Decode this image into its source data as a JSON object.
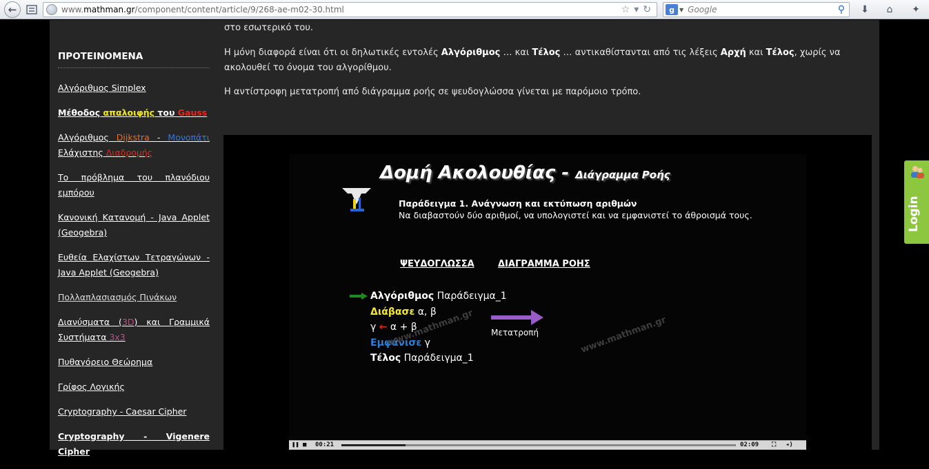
{
  "browser": {
    "url_prefix": "www.",
    "url_host": "mathman.gr",
    "url_path": "/component/content/article/9/268-ae-m02-30.html",
    "search_placeholder": "Google",
    "search_engine_letter": "g"
  },
  "sidebar": {
    "title": "ΠΡΟΤΕΙΝΟΜΕΝΑ",
    "items": {
      "simplex": "Αλγόριθμος Simplex",
      "gauss_1": "Μέθοδος ",
      "gauss_2": "απαλοιφής",
      "gauss_3": " του ",
      "gauss_4": "Gauss",
      "dijkstra_1": "Αλγόριθμος ",
      "dijkstra_2": "Dijkstra",
      "dijkstra_3": " - ",
      "dijkstra_4": "Μονοπάτι",
      "dijkstra_5": " Ελάχιστης ",
      "dijkstra_6": "Διαδρομής",
      "tsp": "Το πρόβλημα του πλανόδιου εμπόρου",
      "normal": "Κανονική Κατανομή - Java Applet (Geogebra)",
      "least_squares": "Ευθεία Ελαχίστων Τετραγώνων - Java Applet (Geogebra)",
      "matrix": "Πολλαπλασιασμός Πινάκων",
      "vectors_1": "Διανύσματα (",
      "vectors_2": "3D",
      "vectors_3": ") και Γραμμικά Συστήματα ",
      "vectors_4": "3x3",
      "pythagoras": "Πυθαγόρειο Θεώρημα",
      "logic": "Γρίφος Λογικής",
      "caesar": "Cryptography - Caesar Cipher",
      "vigenere": "Cryptography - Vigenere Cipher"
    }
  },
  "content": {
    "p0": "στο εσωτερικό του.",
    "p1_a": "Η μόνη διαφορά είναι ότι οι δηλωτικές εντολές ",
    "p1_b": "Αλγόριθμος",
    "p1_c": " … και ",
    "p1_d": "Τέλος",
    "p1_e": " … αντικαθίστανται από τις λέξεις ",
    "p1_f": "Αρχή",
    "p1_g": " και ",
    "p1_h": "Τέλος",
    "p1_i": ", χωρίς να ακολουθεί το όνομα του αλγορίθμου.",
    "p2": "Η αντίστροφη μετατροπή από διάγραμμα ροής σε ψευδογλώσσα γίνεται με παρόμοιο τρόπο."
  },
  "video": {
    "title_main": "Δομή Ακολουθίας - ",
    "title_sub": "Διάγραμμα Ροής",
    "example_title": "Παράδειγμα 1. Ανάγνωση και εκτύπωση αριθμών",
    "example_desc": "Να διαβαστούν δύο αριθμοί, να υπολογιστεί και να εμφανιστεί το άθροισμά τους.",
    "col_pseudo": "ΨΕΥΔΟΓΛΩΣΣΑ",
    "col_flow": "ΔΙΑΓΡΑΜΜΑ ΡΟΗΣ",
    "code": {
      "l1_kw": "Αλγόριθμος",
      "l1_rest": " Παράδειγμα_1",
      "l2_kw": "Διάβασε",
      "l2_rest": "  α, β",
      "l3_a": "γ ",
      "l3_arrow": "←",
      "l3_b": " α + β",
      "l4_kw": "Εμφάνισε",
      "l4_rest": "  γ",
      "l5_kw": "Τέλος",
      "l5_rest": "  Παράδειγμα_1"
    },
    "convert_label": "Μετατροπή",
    "watermark": "www.mathman.gr",
    "time_current": "00:21",
    "time_total": "02:09",
    "progress": 0.163
  },
  "login": {
    "label": "Login"
  },
  "colors": {
    "login_green": "#8dc63f",
    "panel": "#262626",
    "accent_yellow": "#f4e81a",
    "accent_red": "#e8281c"
  }
}
